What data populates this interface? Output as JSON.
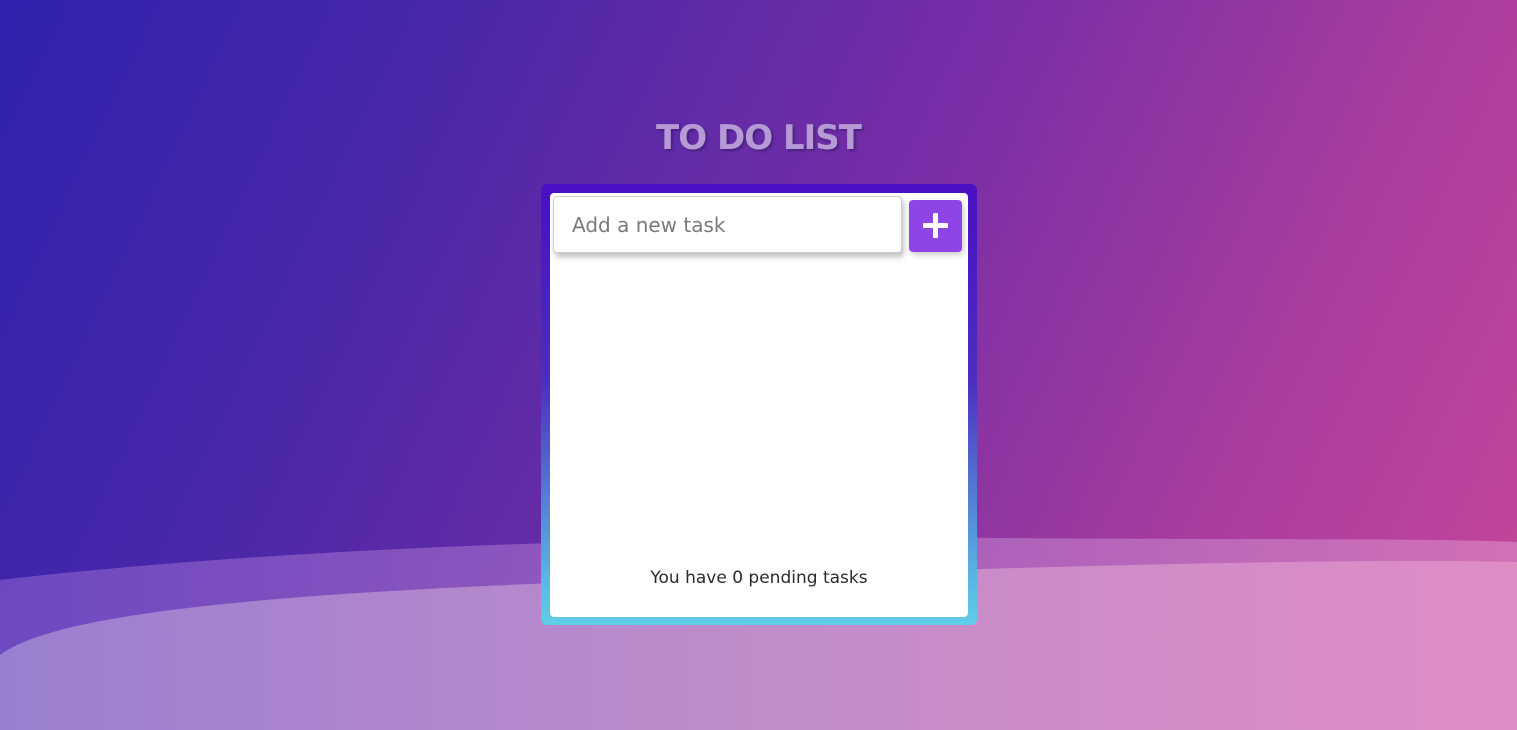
{
  "app": {
    "title": "TO DO LIST"
  },
  "input": {
    "placeholder": "Add a new task",
    "value": ""
  },
  "add_button": {
    "icon": "plus-icon"
  },
  "tasks": [],
  "footer": {
    "pending_text": "You have 0 pending tasks",
    "pending_count": 0
  },
  "colors": {
    "background_start": "#2f22ad",
    "background_end": "#c9469a",
    "frame_top": "#4a0fc4",
    "frame_bottom": "#5fcde8",
    "accent": "#8e44e6",
    "title": "#b59ad6"
  }
}
